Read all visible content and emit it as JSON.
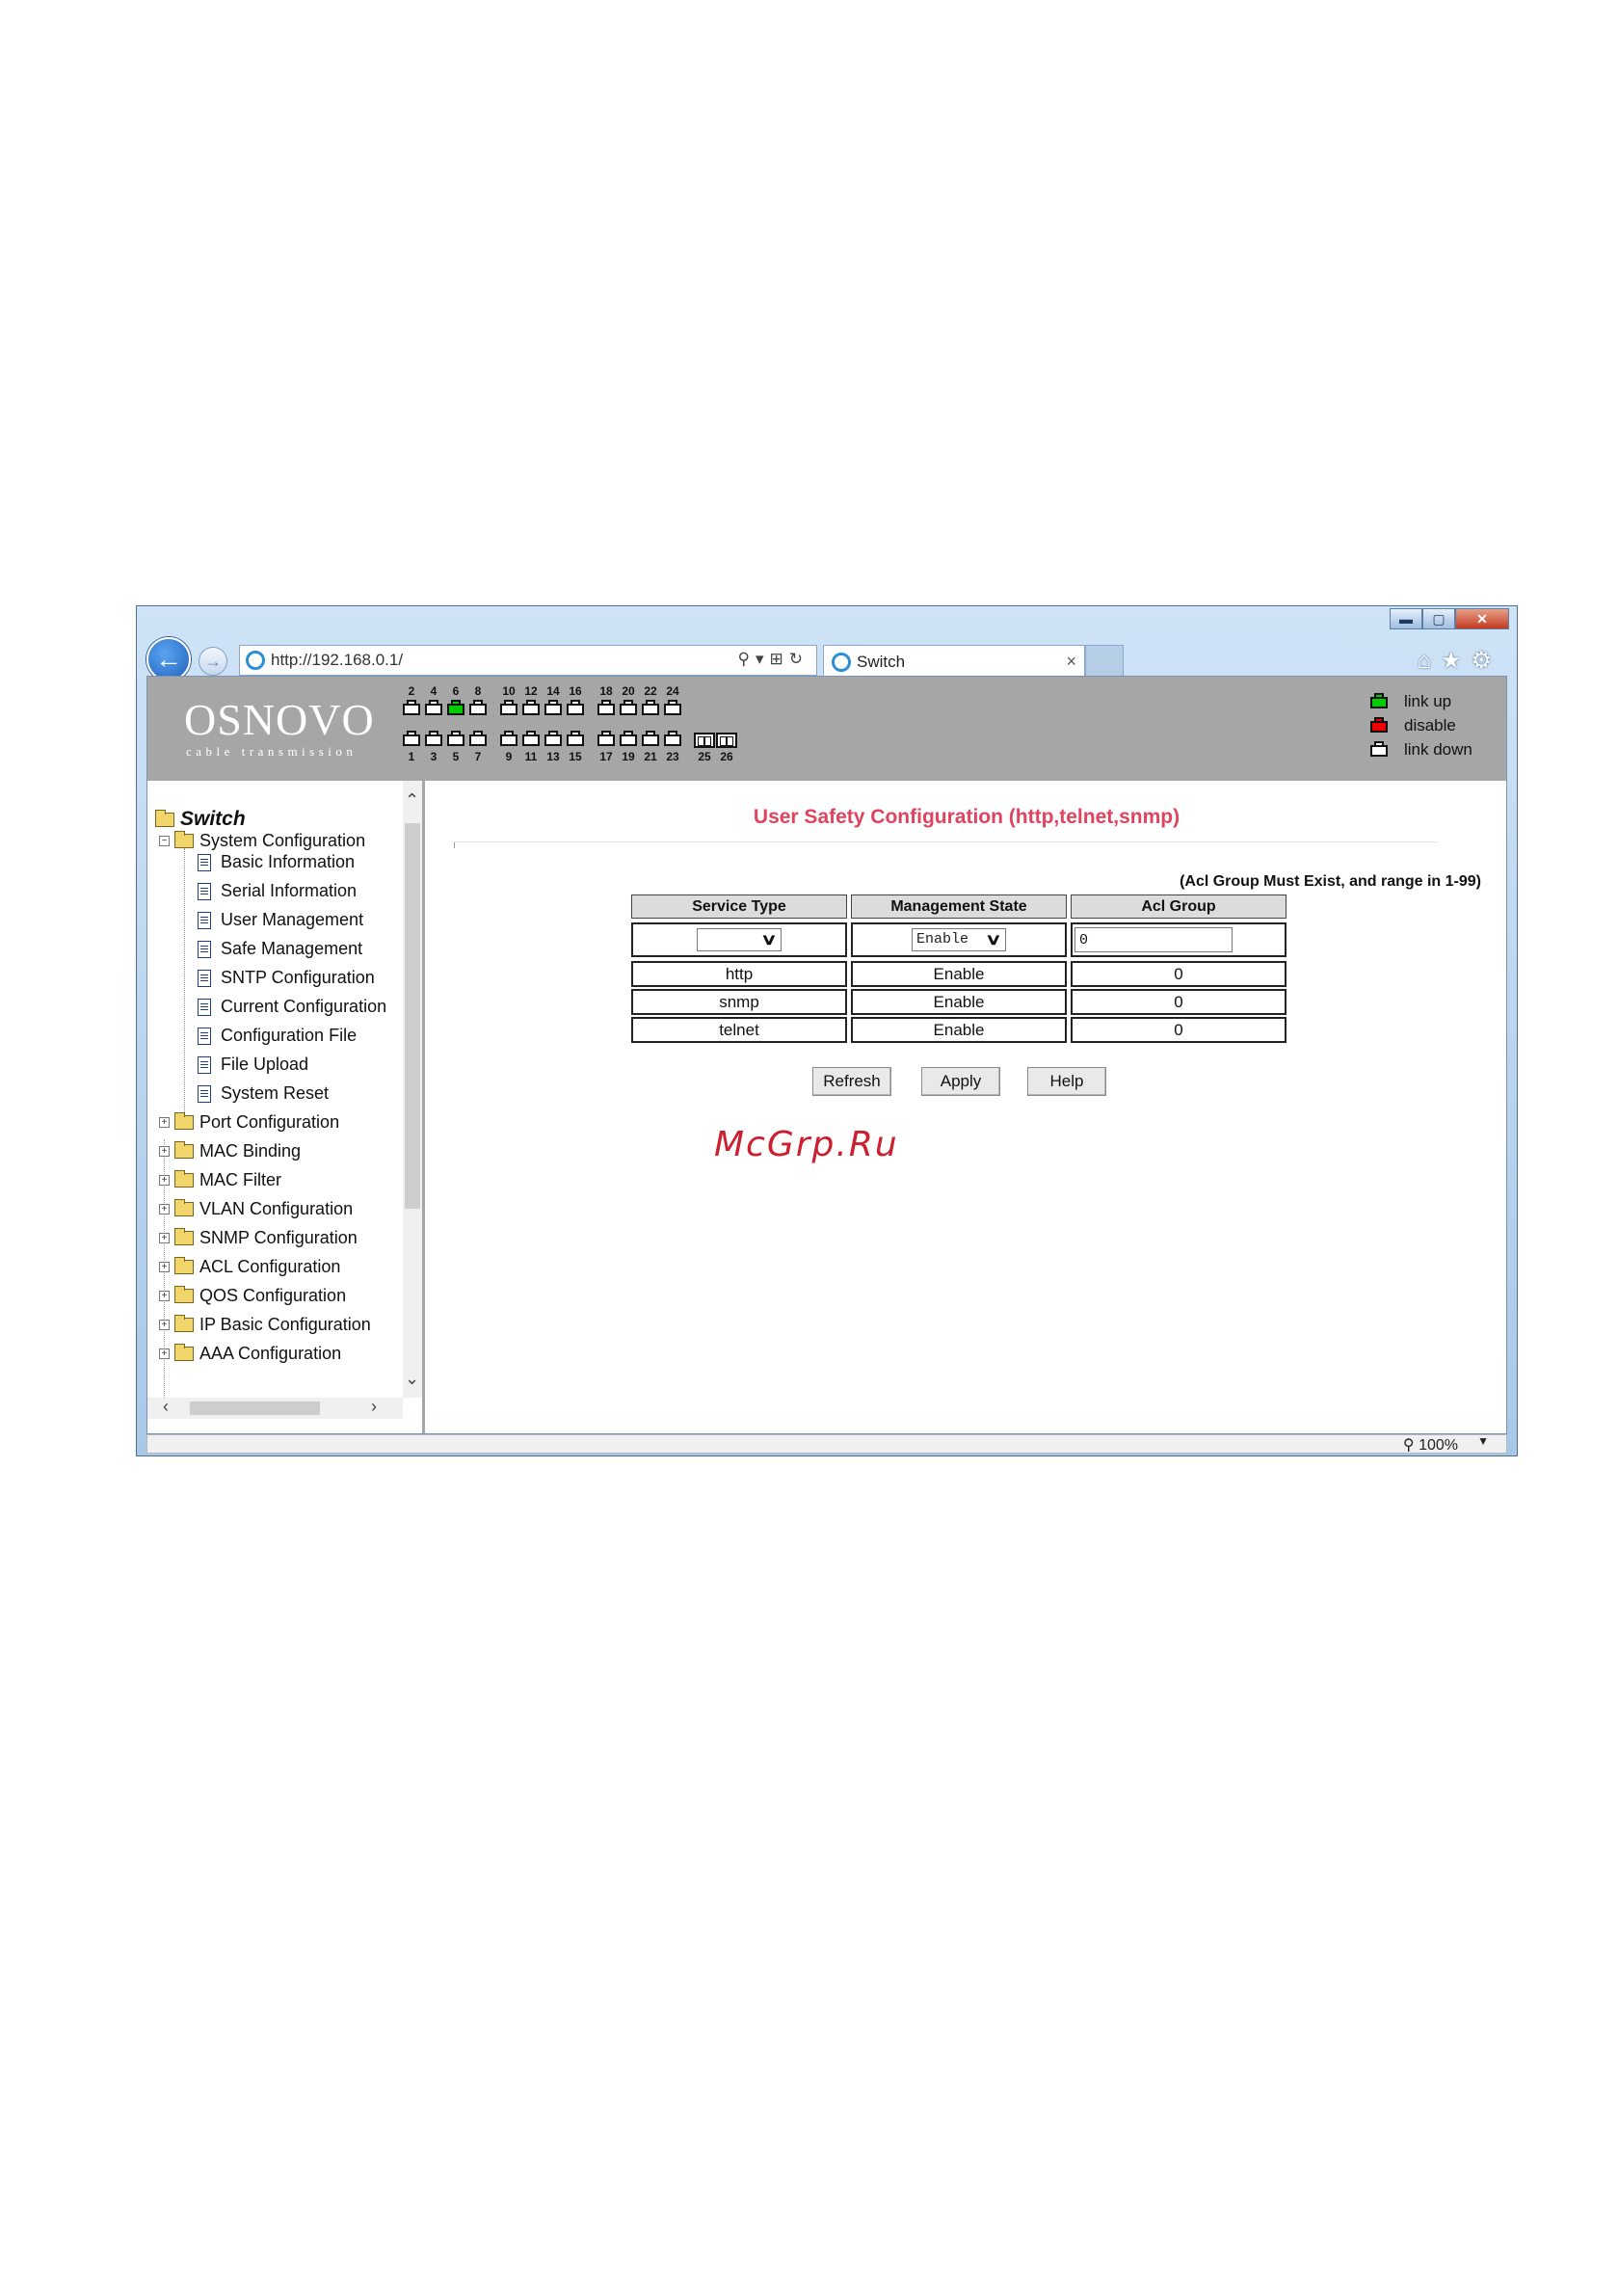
{
  "browser": {
    "address": "http://192.168.0.1/",
    "tab_title": "Switch",
    "tab_close": "×",
    "zoom": "100%",
    "minimize": "▬",
    "maximize": "▢",
    "close": "✕",
    "back": "←",
    "forward": "→",
    "addr_tools": "⚲▾⊞↻",
    "toolbar_icons": "⌂★⚙"
  },
  "header": {
    "logo": "OSNOVO",
    "logo_sub": "cable transmission",
    "ports_top": [
      "2",
      "4",
      "6",
      "8",
      "10",
      "12",
      "14",
      "16",
      "18",
      "20",
      "22",
      "24"
    ],
    "ports_bottom": [
      "1",
      "3",
      "5",
      "7",
      "9",
      "11",
      "13",
      "15",
      "17",
      "19",
      "21",
      "23",
      "25",
      "26"
    ],
    "port_states_top": [
      "down",
      "down",
      "up",
      "down",
      "down",
      "down",
      "down",
      "down",
      "down",
      "down",
      "down",
      "down"
    ],
    "port_states_bottom": [
      "down",
      "down",
      "down",
      "down",
      "down",
      "down",
      "down",
      "down",
      "down",
      "down",
      "down",
      "down"
    ],
    "legend": [
      {
        "label": "link up",
        "state": "up"
      },
      {
        "label": "disable",
        "state": "dis"
      },
      {
        "label": "link down",
        "state": "down"
      }
    ],
    "colors": {
      "link_up": "#00cc00",
      "disable": "#ee0000",
      "link_down": "#ffffff"
    }
  },
  "sidebar": {
    "root": "Switch",
    "open_folder": "System Configuration",
    "children": [
      "Basic Information",
      "Serial Information",
      "User Management",
      "Safe Management",
      "SNTP Configuration",
      "Current Configuration",
      "Configuration File",
      "File Upload",
      "System Reset"
    ],
    "folders": [
      "Port Configuration",
      "MAC Binding",
      "MAC Filter",
      "VLAN Configuration",
      "SNMP Configuration",
      "ACL Configuration",
      "QOS Configuration",
      "IP Basic Configuration",
      "AAA Configuration"
    ]
  },
  "main": {
    "title": "User Safety Configuration (http,telnet,snmp)",
    "note": "(Acl Group Must Exist, and range in 1-99)",
    "columns": [
      "Service Type",
      "Management State",
      "Acl Group"
    ],
    "form": {
      "service_type": "",
      "management_state": "Enable",
      "acl_group": "0"
    },
    "rows": [
      {
        "service": "http",
        "state": "Enable",
        "acl": "0"
      },
      {
        "service": "snmp",
        "state": "Enable",
        "acl": "0"
      },
      {
        "service": "telnet",
        "state": "Enable",
        "acl": "0"
      }
    ],
    "buttons": {
      "refresh": "Refresh",
      "apply": "Apply",
      "help": "Help"
    },
    "accent_color": "#e0435e"
  },
  "watermark": "McGrp.Ru"
}
